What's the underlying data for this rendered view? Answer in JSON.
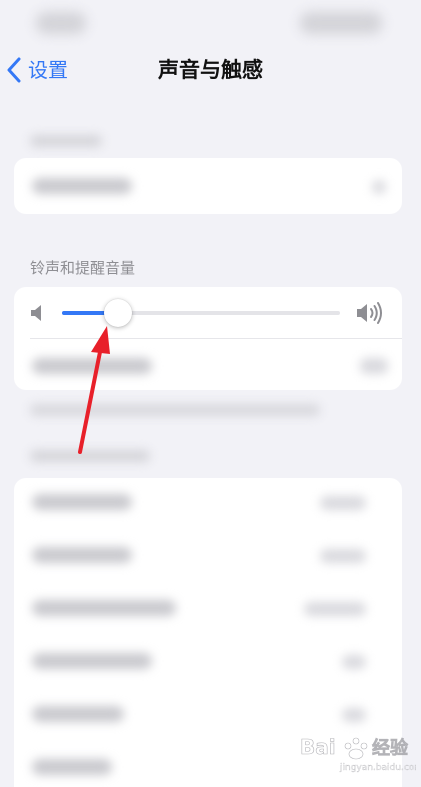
{
  "nav": {
    "back_label": "设置",
    "title": "声音与触感"
  },
  "volume_section": {
    "header": "铃声和提醒音量",
    "level_fraction": 0.2
  },
  "icons": {
    "back": "chevron-left-icon",
    "volume_low": "speaker-low-icon",
    "volume_high": "speaker-high-icon"
  },
  "colors": {
    "accent": "#3478f6",
    "background": "#f2f2f7",
    "annotation_arrow": "#e8202a"
  },
  "watermark": {
    "text": "Baidu 经验",
    "sub": "jingyan.baidu.com"
  }
}
